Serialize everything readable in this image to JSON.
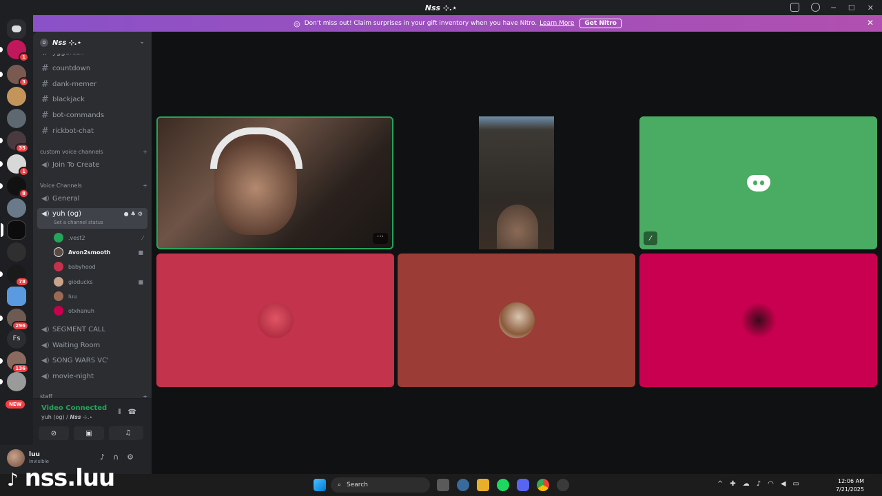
{
  "window": {
    "title": "𝙉𝙨𝙨 ⊹.⋆"
  },
  "banner": {
    "text": "Don't miss out! Claim surprises in your gift inventory when you have Nitro.",
    "link": "Learn More",
    "button": "Get Nitro",
    "close": "✕"
  },
  "servers": {
    "badges": [
      "1",
      "3",
      "35",
      "1",
      "8",
      "78",
      "296",
      "136"
    ],
    "fs_label": "Fs",
    "new_label": "NEW"
  },
  "guild": {
    "name": "𝙉𝙨𝙨 ⊹.⋆",
    "boost": "0",
    "partial_channel": "yggdrasil"
  },
  "channels": {
    "text": [
      "countdown",
      "dank-memer",
      "blackjack",
      "bot-commands",
      "rickbot-chat"
    ],
    "category_custom": "custom voice channels",
    "join_to_create": "Join To Create",
    "category_voice": "Voice Channels",
    "general": "General",
    "active": {
      "name": "yuh (og)",
      "status": "Set a channel status"
    },
    "members": [
      ".vest2",
      "Avon2smooth",
      "babyhood",
      "gioducks",
      "luu",
      "otxhanuh"
    ],
    "voice_more": [
      "SEGMENT CALL",
      "Waiting Room",
      "SONG WARS VC'",
      "movie-night"
    ],
    "category_staff": "staff"
  },
  "voice": {
    "status": "Video Connected",
    "location": "yuh (og) / 𝙉𝙨𝙨 ⊹.⋆"
  },
  "user": {
    "name": "luu",
    "status": "Invisible"
  },
  "tiles": {
    "colors": {
      "green": "#4aab62",
      "red1": "#c3334c",
      "red2": "#9b3d36",
      "pink": "#c8004f"
    }
  },
  "taskbar": {
    "watermark": "nss.luu",
    "search": "Search",
    "time": "12:06 AM",
    "date": "7/21/2025"
  }
}
